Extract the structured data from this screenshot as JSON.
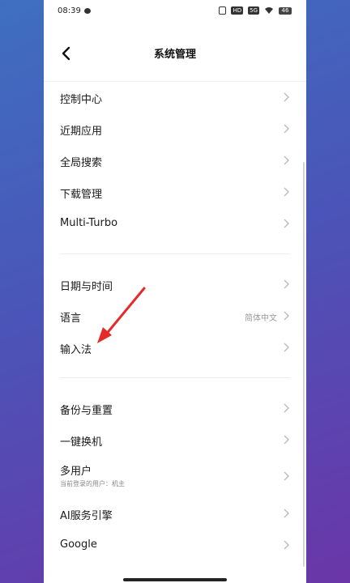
{
  "status": {
    "time": "08:39",
    "network": "5G",
    "battery": "46"
  },
  "header": {
    "title": "系统管理"
  },
  "group1": [
    {
      "label": "控制中心"
    },
    {
      "label": "近期应用"
    },
    {
      "label": "全局搜索"
    },
    {
      "label": "下载管理"
    },
    {
      "label": "Multi-Turbo"
    }
  ],
  "group2": [
    {
      "label": "日期与时间"
    },
    {
      "label": "语言",
      "value": "简体中文"
    },
    {
      "label": "输入法"
    }
  ],
  "group3": [
    {
      "label": "备份与重置"
    },
    {
      "label": "一键换机"
    },
    {
      "label": "多用户",
      "sub": "当前登录的用户：机主"
    },
    {
      "label": "AI服务引擎"
    },
    {
      "label": "Google"
    }
  ],
  "colors": {
    "annotation_arrow": "#e52a2a"
  }
}
